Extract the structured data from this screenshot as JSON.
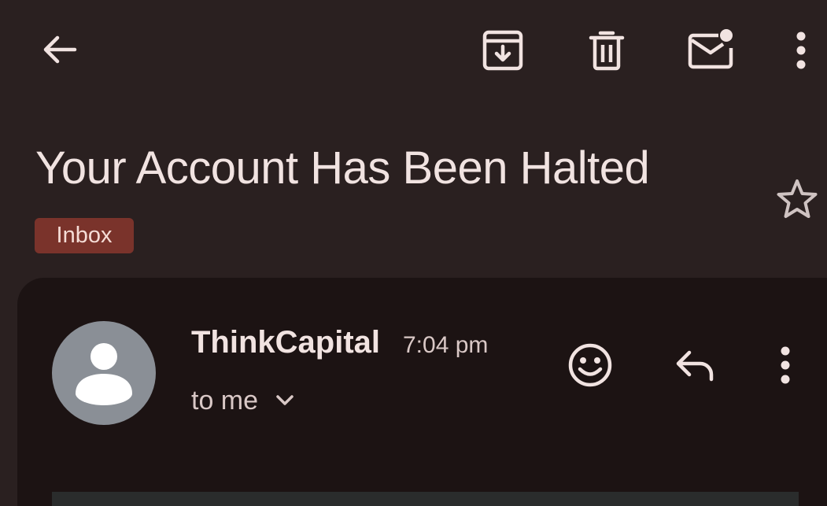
{
  "toolbar": {
    "back_icon": "arrow-left-icon",
    "archive_icon": "archive-icon",
    "delete_icon": "trash-icon",
    "mark_unread_icon": "mail-unread-icon",
    "more_icon": "more-vertical-icon"
  },
  "email": {
    "subject": "Your Account Has Been Halted",
    "label": "Inbox",
    "starred": false
  },
  "message": {
    "sender": "ThinkCapital",
    "time": "7:04 pm",
    "recipient": "to me",
    "actions": [
      "emoji-reaction-icon",
      "reply-icon",
      "more-vertical-icon"
    ]
  },
  "colors": {
    "background": "#2a2020",
    "card": "#1c1313",
    "text": "#f1e3e1",
    "label_chip": "#7a332b",
    "avatar": "#8a8f96"
  }
}
